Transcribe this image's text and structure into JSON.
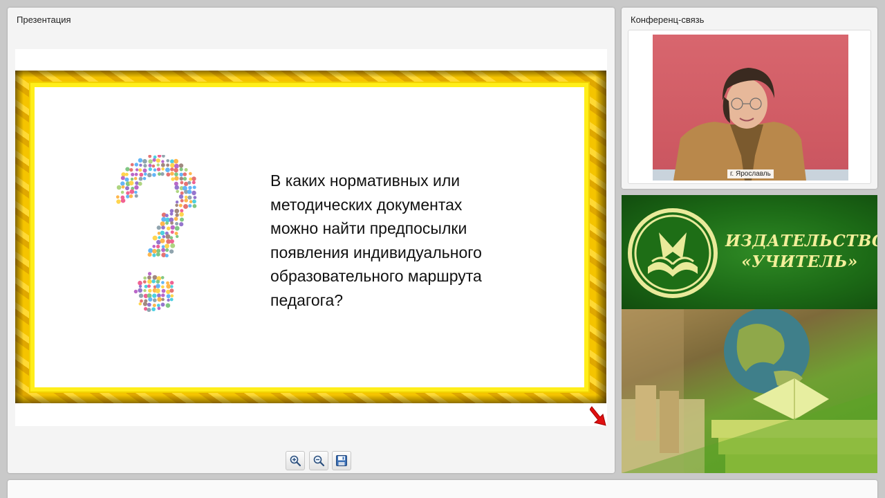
{
  "presentation_panel": {
    "title": "Презентация",
    "slide": {
      "question": "В каких нормативных или\nметодических документах\nможно найти предпосылки\nпоявления индивидуального\nобразовательного маршрута\nпедагога?"
    },
    "toolbar": {
      "zoom_in_icon": "zoom-in-icon",
      "zoom_out_icon": "zoom-out-icon",
      "save_icon": "save-icon"
    }
  },
  "conference_panel": {
    "title": "Конференц-связь",
    "video_label": "г. Ярославль"
  },
  "ad": {
    "publisher_line1": "ИЗДАТЕЛЬСТВО",
    "publisher_line2": "«УЧИТЕЛЬ»"
  },
  "colors": {
    "slide_border": "#f2c000",
    "slide_inner_border": "#ffee1a",
    "ad_green": "#1c6a16",
    "ad_text": "#f3ef9a",
    "video_background": "#d8666e"
  }
}
